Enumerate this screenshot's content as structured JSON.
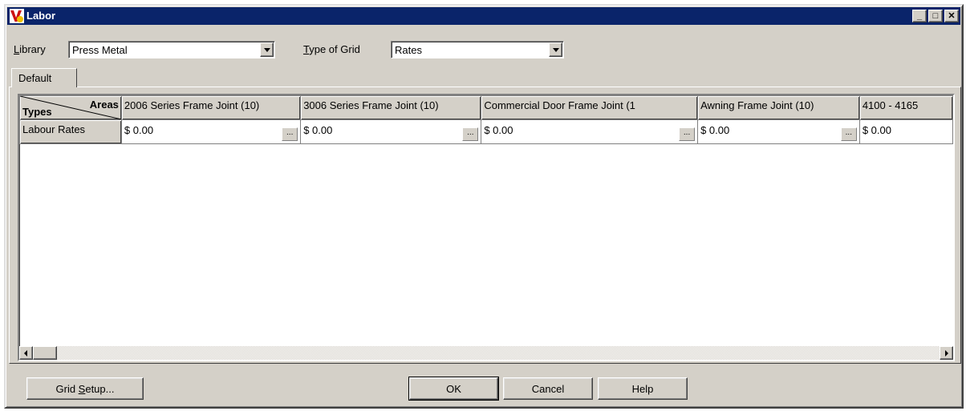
{
  "window": {
    "title": "Labor",
    "controls": {
      "minimize": "_",
      "maximize": "□",
      "close": "✕"
    }
  },
  "toolbar": {
    "library_label_u": "L",
    "library_label_rest": "ibrary",
    "library_value": "Press Metal",
    "grid_type_label_u": "T",
    "grid_type_label_rest": "ype of Grid",
    "grid_type_value": "Rates"
  },
  "tabs": [
    {
      "label": "Default"
    }
  ],
  "grid": {
    "corner_top": "Areas",
    "corner_bottom": "Types",
    "columns": [
      "2006 Series Frame Joint (10)",
      "3006 Series Frame Joint (10)",
      "Commercial Door Frame Joint (1",
      "Awning Frame Joint (10)",
      "4100 - 4165"
    ],
    "rows": [
      {
        "label": "Labour Rates",
        "values": [
          "$ 0.00",
          "$ 0.00",
          "$ 0.00",
          "$ 0.00",
          "$ 0.00"
        ]
      }
    ],
    "ellipsis": "..."
  },
  "buttons": {
    "grid_setup_pre": "Grid ",
    "grid_setup_u": "S",
    "grid_setup_post": "etup...",
    "ok": "OK",
    "cancel": "Cancel",
    "help": "Help"
  }
}
